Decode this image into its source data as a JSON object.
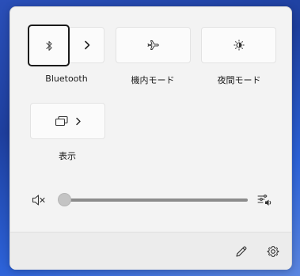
{
  "quick_settings": {
    "bluetooth": {
      "label": "Bluetooth",
      "icon": "bluetooth-icon",
      "expand_icon": "chevron-right-icon"
    },
    "airplane": {
      "label": "機内モード",
      "icon": "airplane-icon"
    },
    "night_light": {
      "label": "夜間モード",
      "icon": "night-light-icon"
    },
    "display": {
      "label": "表示",
      "icon": "project-display-icon",
      "expand_icon": "chevron-right-icon"
    }
  },
  "volume": {
    "muted_icon": "speaker-muted-icon",
    "level": 0,
    "output_icon": "audio-output-icon"
  },
  "footer": {
    "edit_icon": "pencil-icon",
    "settings_icon": "gear-icon"
  }
}
